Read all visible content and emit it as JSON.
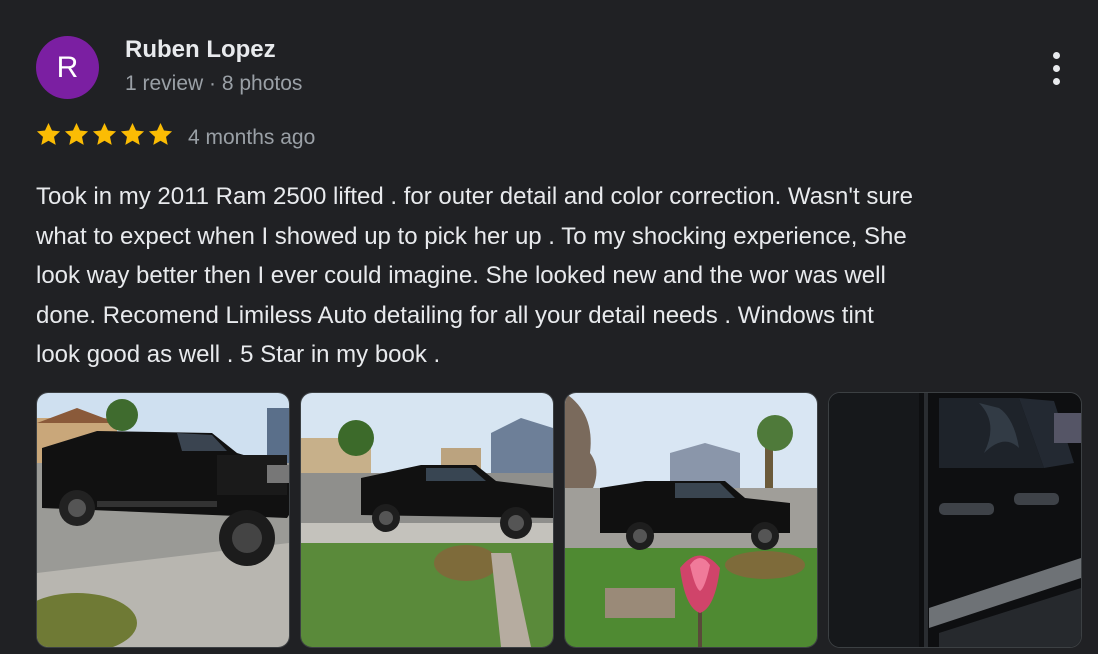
{
  "reviewer": {
    "initial": "R",
    "name": "Ruben Lopez",
    "meta": "1 review · 8 photos",
    "avatar_color": "#7b1fa2"
  },
  "rating": {
    "stars": 5,
    "max": 5,
    "star_color": "#fbbc04"
  },
  "time_ago": "4 months ago",
  "review_lines": [
    "Took in my 2011 Ram 2500 lifted . for outer detail and color correction. Wasn't sure",
    "what to expect when I showed up to pick her up . To my shocking experience, She",
    "look way better then I ever could imagine. She looked new and the wor was well",
    "done. Recomend Limiless Auto detailing for all your detail needs . Windows tint",
    "look good as well . 5 Star in my book ."
  ],
  "photos": [
    {
      "icon": "truck-photo-front-angle"
    },
    {
      "icon": "truck-photo-side"
    },
    {
      "icon": "truck-photo-yard-flower"
    },
    {
      "icon": "truck-photo-door-closeup"
    }
  ],
  "menu_icon": "more-vert-icon"
}
